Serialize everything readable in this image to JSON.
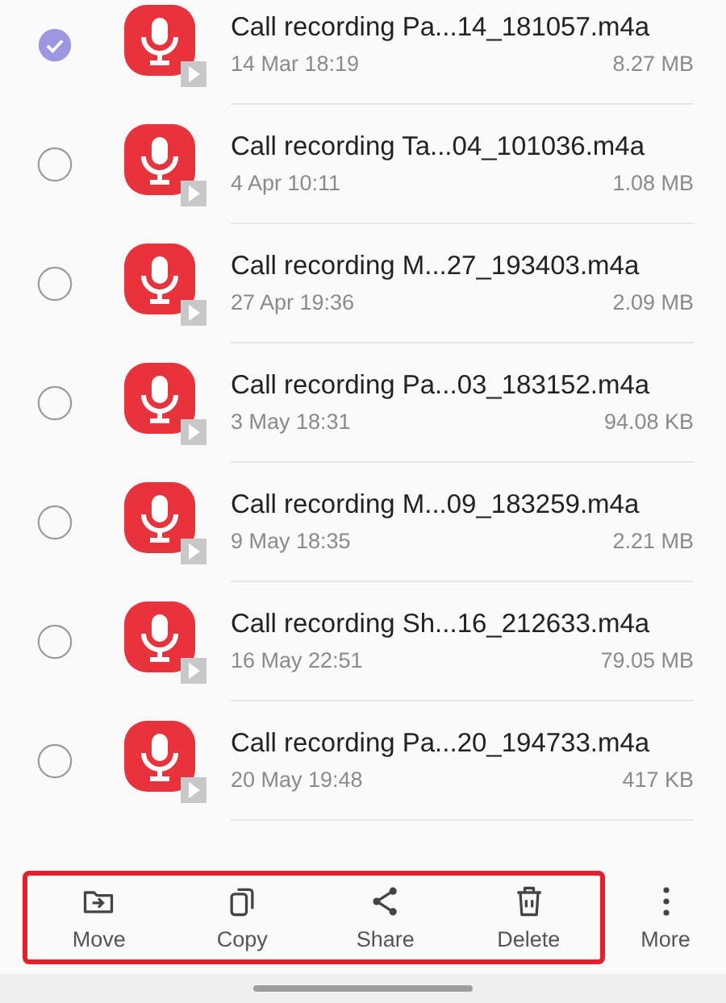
{
  "files": [
    {
      "name": "Call recording Pa...14_181057.m4a",
      "date": "14 Mar 18:19",
      "size": "8.27 MB",
      "selected": true
    },
    {
      "name": "Call recording Ta...04_101036.m4a",
      "date": "4 Apr 10:11",
      "size": "1.08 MB",
      "selected": false
    },
    {
      "name": "Call recording M...27_193403.m4a",
      "date": "27 Apr 19:36",
      "size": "2.09 MB",
      "selected": false
    },
    {
      "name": "Call recording Pa...03_183152.m4a",
      "date": "3 May 18:31",
      "size": "94.08 KB",
      "selected": false
    },
    {
      "name": "Call recording M...09_183259.m4a",
      "date": "9 May 18:35",
      "size": "2.21 MB",
      "selected": false
    },
    {
      "name": "Call recording Sh...16_212633.m4a",
      "date": "16 May 22:51",
      "size": "79.05 MB",
      "selected": false
    },
    {
      "name": "Call recording Pa...20_194733.m4a",
      "date": "20 May 19:48",
      "size": "417 KB",
      "selected": false
    }
  ],
  "actions": [
    {
      "kind": "move",
      "label": "Move",
      "highlighted": true
    },
    {
      "kind": "copy",
      "label": "Copy",
      "highlighted": true
    },
    {
      "kind": "share",
      "label": "Share",
      "highlighted": true
    },
    {
      "kind": "delete",
      "label": "Delete",
      "highlighted": true
    },
    {
      "kind": "more",
      "label": "More",
      "highlighted": false
    }
  ]
}
